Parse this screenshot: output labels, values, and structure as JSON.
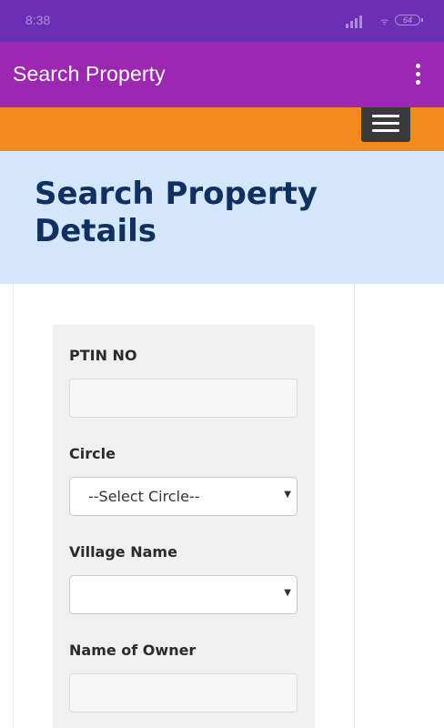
{
  "status_bar": {
    "time": "8:38",
    "battery_level": "64",
    "icons": [
      "signal-icon",
      "wifi-icon",
      "battery-icon"
    ]
  },
  "app_bar": {
    "title": "Search Property",
    "overflow_icon": "more-vert-icon"
  },
  "nav": {
    "menu_icon": "hamburger-menu-icon"
  },
  "banner": {
    "title": "Search Property Details"
  },
  "form": {
    "ptin": {
      "label": "PTIN NO",
      "value": ""
    },
    "circle": {
      "label": "Circle",
      "selected": "--Select Circle--"
    },
    "village": {
      "label": "Village Name",
      "selected": ""
    },
    "owner": {
      "label": "Name of Owner",
      "value": ""
    }
  },
  "colors": {
    "status_bar": "#6a2fb5",
    "app_bar": "#9c27b0",
    "accent_bar": "#f28a1e",
    "banner_bg": "#d3e6fa",
    "banner_text": "#0f3060",
    "form_bg": "#f0f0f0"
  }
}
